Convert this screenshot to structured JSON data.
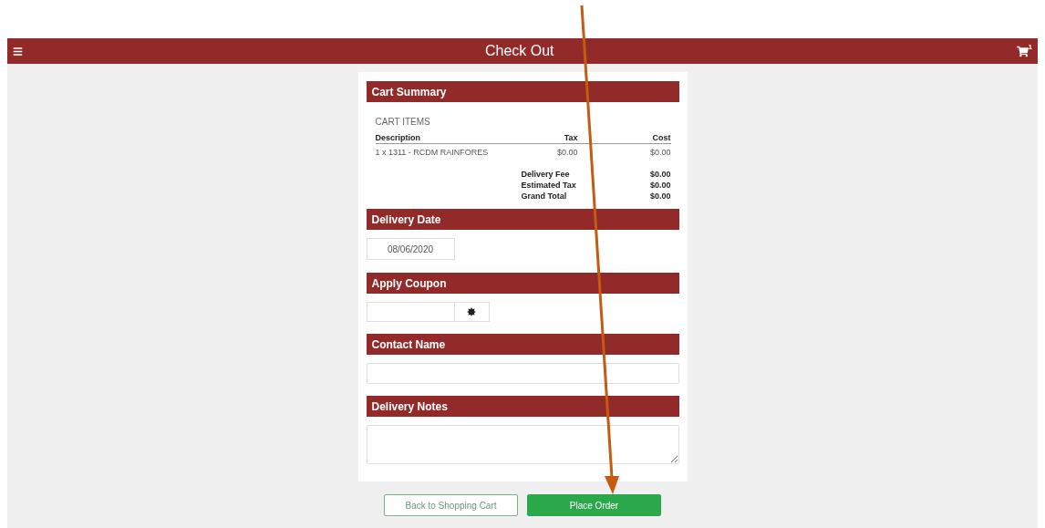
{
  "header": {
    "title": "Check Out",
    "cart_count": "1"
  },
  "cart_summary": {
    "heading": "Cart Summary",
    "subheading": "CART ITEMS",
    "columns": [
      "Description",
      "Tax",
      "Cost"
    ],
    "rows": [
      {
        "description": "1 x 1311 - RCDM RAINFORES",
        "tax": "$0.00",
        "cost": "$0.00"
      }
    ],
    "totals": [
      {
        "label": "Delivery Fee",
        "value": "$0.00"
      },
      {
        "label": "Estimated Tax",
        "value": "$0.00"
      },
      {
        "label": "Grand Total",
        "value": "$0.00"
      }
    ]
  },
  "delivery_date": {
    "heading": "Delivery Date",
    "value": "08/06/2020"
  },
  "apply_coupon": {
    "heading": "Apply Coupon"
  },
  "contact_name": {
    "heading": "Contact Name"
  },
  "delivery_notes": {
    "heading": "Delivery Notes"
  },
  "buttons": [
    {
      "label": "Back to Shopping Cart",
      "kind": "secondary"
    },
    {
      "label": "Place Order",
      "kind": "primary"
    }
  ]
}
